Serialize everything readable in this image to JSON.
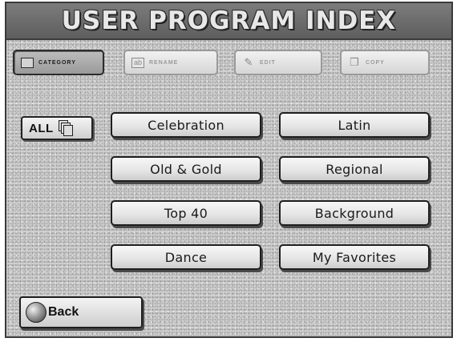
{
  "header": {
    "title": "USER PROGRAM INDEX"
  },
  "tabs": [
    {
      "label": "CATEGORY",
      "active": true,
      "icon": "category-icon"
    },
    {
      "label": "RENAME",
      "active": false,
      "icon": "rename-icon"
    },
    {
      "label": "EDIT",
      "active": false,
      "icon": "edit-icon"
    },
    {
      "label": "COPY",
      "active": false,
      "icon": "copy-icon"
    }
  ],
  "all_button": {
    "label": "ALL",
    "icon": "stacked-pages-icon"
  },
  "categories": [
    {
      "label": "Celebration"
    },
    {
      "label": "Latin"
    },
    {
      "label": "Old & Gold"
    },
    {
      "label": "Regional"
    },
    {
      "label": "Top 40"
    },
    {
      "label": "Background"
    },
    {
      "label": "Dance"
    },
    {
      "label": "My Favorites"
    }
  ],
  "back_button": {
    "label": "Back",
    "icon": "back-knob-icon"
  },
  "colors": {
    "titlebar": "#6f6f6f",
    "screen_bg": "#cfcfcf",
    "border": "#1e1e1e"
  }
}
